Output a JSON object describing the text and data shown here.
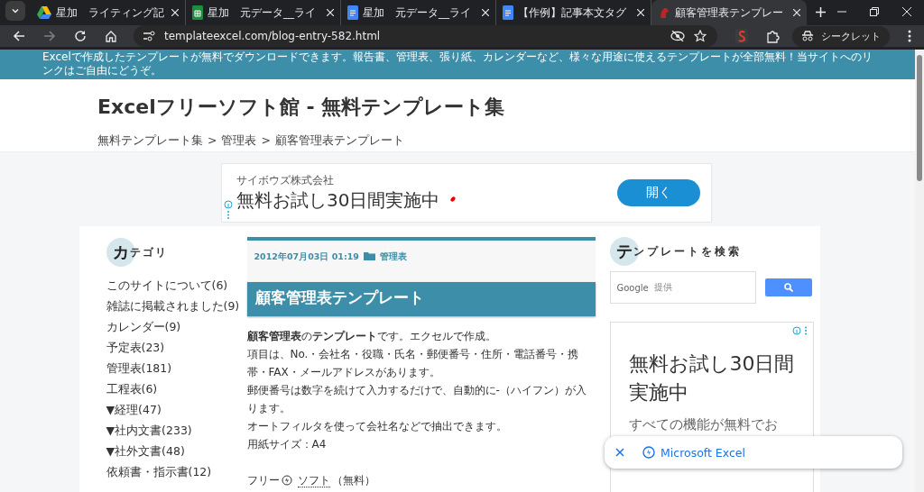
{
  "tabs": [
    {
      "title": "星加　ライティング記",
      "kind": "drive",
      "selected": false
    },
    {
      "title": "星加　元データ__ライ",
      "kind": "sheets",
      "selected": false
    },
    {
      "title": "星加　元データ__ライ",
      "kind": "docs",
      "selected": false
    },
    {
      "title": "【作例】記事本文タグ",
      "kind": "docs",
      "selected": false
    },
    {
      "title": "顧客管理表テンプレー",
      "kind": "site",
      "selected": true
    }
  ],
  "address": "templateexcel.com/blog-entry-582.html",
  "profile_label": "シークレット",
  "site": {
    "banner": "Excelで作成したテンプレートが無料でダウンロードできます。報告書、管理表、張り紙、カレンダーなど、様々な用途に使えるテンプレートが全部無料！当サイトへのリンクはご自由にどうぞ。",
    "title": "Excelフリーソフト館 - 無料テンプレート集",
    "breadcrumb": [
      "無料テンプレート集",
      "管理表",
      "顧客管理表テンプレート"
    ],
    "breadcrumb_separator": ">"
  },
  "top_ad": {
    "advertiser": "サイボウズ株式会社",
    "headline": "無料お試し30日間実施中",
    "button": "開く"
  },
  "categories": {
    "initial": "カ",
    "rest": "テゴリ",
    "items": [
      "このサイトについて(6)",
      "雑誌に掲載されました(9)",
      "カレンダー(9)",
      "予定表(23)",
      "管理表(181)",
      "工程表(6)",
      "▼経理(47)",
      "▼社内文書(233)",
      "▼社外文書(48)",
      "依頼書・指示書(12)"
    ]
  },
  "article": {
    "date": "2012年07月03日 01:19",
    "category": "管理表",
    "title": "顧客管理表テンプレート",
    "paragraphs": [
      "**顧客管理表**の**テンプレート**です。エクセルで作成。",
      "項目は、No.・会社名・役職・氏名・郵便番号・住所・電話番号・携帯・FAX・メールアドレスがあります。",
      "郵便番号は数字を続けて入力するだけで、自動的に-（ハイフン）が入ります。",
      "オートフィルタを使って会社名などで抽出できます。",
      "用紙サイズ：A4"
    ],
    "free_prefix": "フリー",
    "free_link": "ソフト",
    "free_suffix": "（無料）"
  },
  "search": {
    "initial": "テ",
    "rest": "ンプレートを検索",
    "brand": "Google",
    "brand_note": "提供"
  },
  "side_ad": {
    "headline": "無料お試し30日間実施中",
    "body": "すべての機能が無料でお"
  },
  "popup": {
    "label": "Microsoft Excel"
  }
}
